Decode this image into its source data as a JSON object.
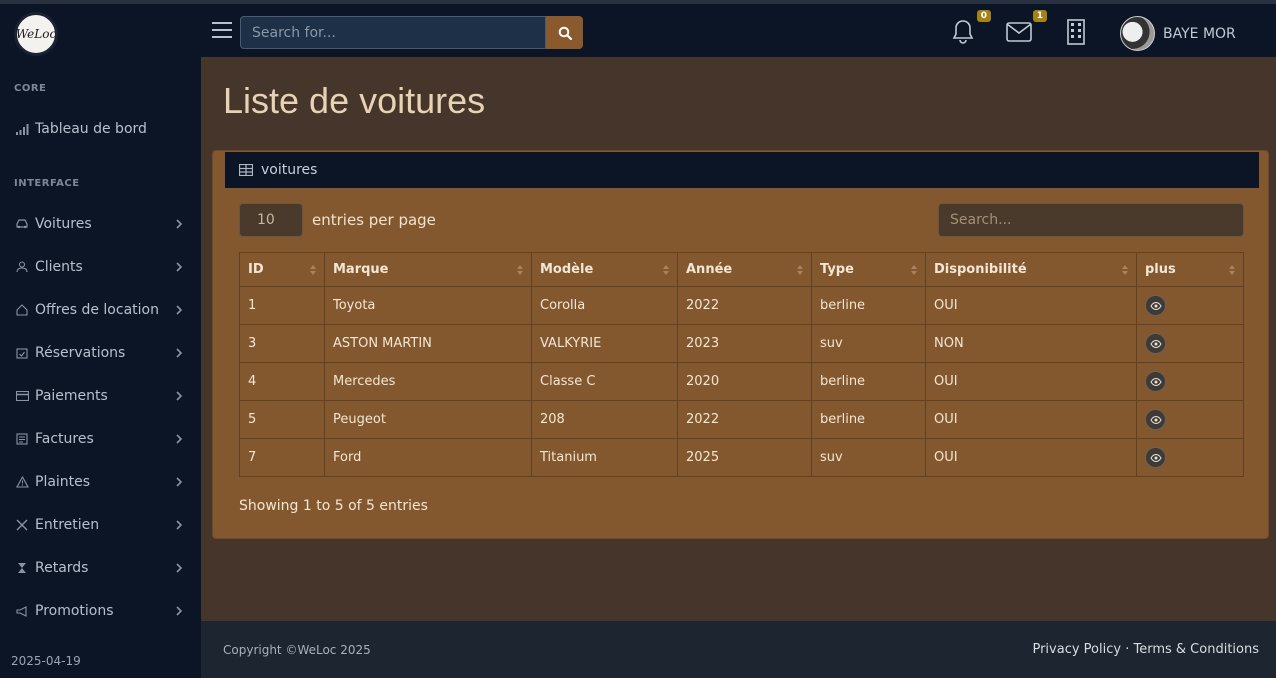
{
  "brand": {
    "logo_text": "WeLoc"
  },
  "topnav": {
    "search_placeholder": "Search for...",
    "notifications_count": "0",
    "messages_count": "1",
    "user_name": "BAYE MOR"
  },
  "sidebar": {
    "core_heading": "CORE",
    "dashboard_label": "Tableau de bord",
    "interface_heading": "INTERFACE",
    "items": [
      {
        "label": "Voitures",
        "icon": "car-icon"
      },
      {
        "label": "Clients",
        "icon": "user-icon"
      },
      {
        "label": "Offres de location",
        "icon": "home-icon"
      },
      {
        "label": "Réservations",
        "icon": "calendar-check-icon"
      },
      {
        "label": "Paiements",
        "icon": "credit-card-icon"
      },
      {
        "label": "Factures",
        "icon": "invoice-icon"
      },
      {
        "label": "Plaintes",
        "icon": "warning-icon"
      },
      {
        "label": "Entretien",
        "icon": "tools-icon"
      },
      {
        "label": "Retards",
        "icon": "hourglass-icon"
      },
      {
        "label": "Promotions",
        "icon": "megaphone-icon"
      }
    ],
    "date": "2025-04-19"
  },
  "main": {
    "page_title": "Liste de voitures",
    "card_title": "voitures",
    "per_page_value": "10",
    "per_page_label": "entries per page",
    "table_search_placeholder": "Search...",
    "columns": [
      "ID",
      "Marque",
      "Modèle",
      "Année",
      "Type",
      "Disponibilité",
      "plus"
    ],
    "rows": [
      [
        "1",
        "Toyota",
        "Corolla",
        "2022",
        "berline",
        "OUI"
      ],
      [
        "3",
        "ASTON MARTIN",
        "VALKYRIE",
        "2023",
        "suv",
        "NON"
      ],
      [
        "4",
        "Mercedes",
        "Classe C",
        "2020",
        "berline",
        "OUI"
      ],
      [
        "5",
        "Peugeot",
        "208",
        "2022",
        "berline",
        "OUI"
      ],
      [
        "7",
        "Ford",
        "Titanium",
        "2025",
        "suv",
        "OUI"
      ]
    ],
    "showing_text": "Showing 1 to 5 of 5 entries"
  },
  "footer": {
    "copyright": "Copyright ©WeLoc 2025",
    "privacy": "Privacy Policy",
    "separator": "·",
    "terms": "Terms & Conditions"
  },
  "colors": {
    "navbar": "#0b1526",
    "content_bg": "#45352a",
    "card_bg": "#83582f",
    "accent": "#8a5a2e",
    "badge": "#a58217"
  }
}
